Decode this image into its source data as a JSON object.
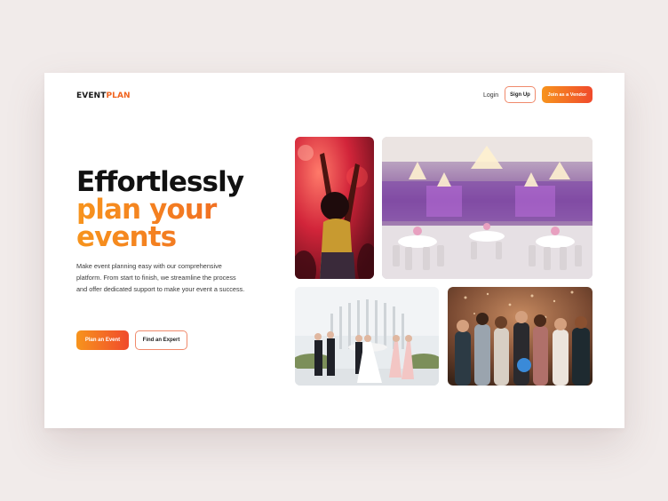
{
  "brand": {
    "part1": "EVENT",
    "part2": "PLAN",
    "dark_color": "#1b1b1b",
    "accent_color": "#f0641f"
  },
  "nav": {
    "login": "Login",
    "signup": "Sign Up",
    "vendor": "Join as a Vendor"
  },
  "hero": {
    "line1": "Effortlessly",
    "line2": "plan your",
    "line3": "events",
    "description": "Make event planning easy with our comprehensive platform. From start to finish, we streamline the process and offer dedicated support to make your event a success.",
    "primary_cta": "Plan an Event",
    "secondary_cta": "Find an Expert"
  },
  "colors": {
    "gradient_start": "#f7941d",
    "gradient_end": "#f04a2c",
    "page_bg": "#f1ebea"
  },
  "gallery": [
    "party-photo",
    "banquet-hall-photo",
    "wedding-ceremony-photo",
    "celebration-group-photo"
  ]
}
